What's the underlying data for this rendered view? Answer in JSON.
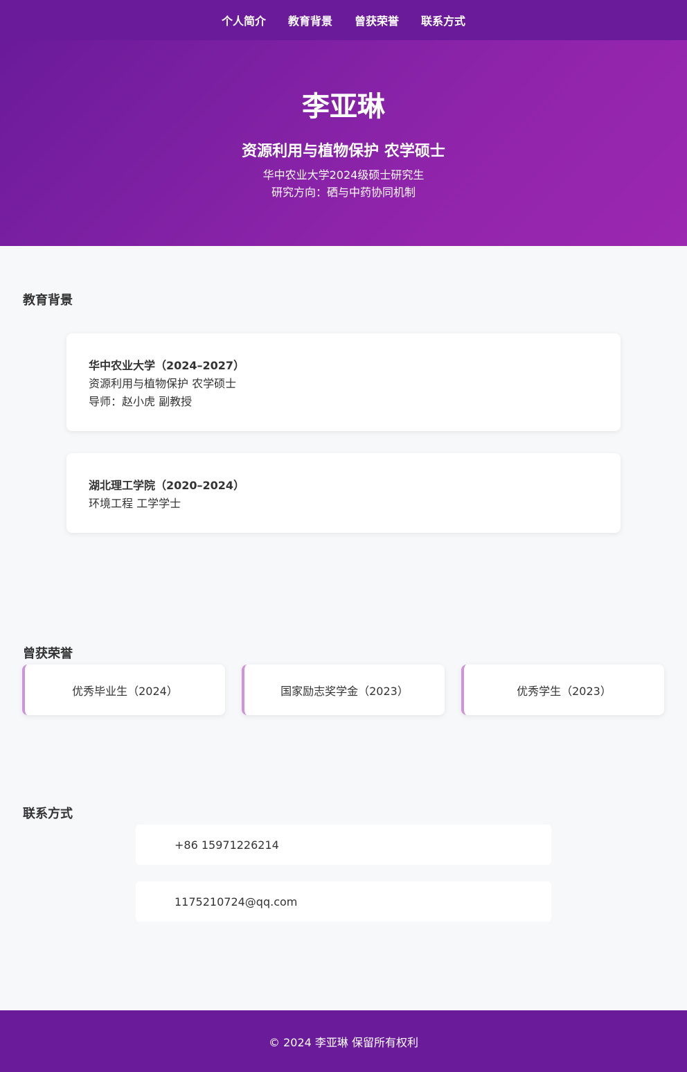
{
  "nav": {
    "items": [
      "个人简介",
      "教育背景",
      "曾获荣誉",
      "联系方式"
    ]
  },
  "hero": {
    "name": "李亚琳",
    "degree": "资源利用与植物保护 农学硕士",
    "line1": "华中农业大学2024级硕士研究生",
    "line2": "研究方向：硒与中药协同机制"
  },
  "education": {
    "title": "教育背景",
    "cards": [
      {
        "title": "华中农业大学（2024–2027）",
        "lines": [
          "资源利用与植物保护 农学硕士",
          "导师：赵小虎 副教授"
        ]
      },
      {
        "title": "湖北理工学院（2020–2024）",
        "lines": [
          "环境工程 工学学士"
        ]
      }
    ]
  },
  "honors": {
    "title": "曾获荣誉",
    "items": [
      "优秀毕业生（2024）",
      "国家励志奖学金（2023）",
      "优秀学生（2023）"
    ]
  },
  "contact": {
    "title": "联系方式",
    "phone": "+86 15971226214",
    "email": "1175210724@qq.com"
  },
  "footer": {
    "text": "© 2024 李亚琳 保留所有权利"
  },
  "colors": {
    "primary": "#6a1b9a",
    "accent": "#ce93d8",
    "background": "#f7f8fa"
  }
}
